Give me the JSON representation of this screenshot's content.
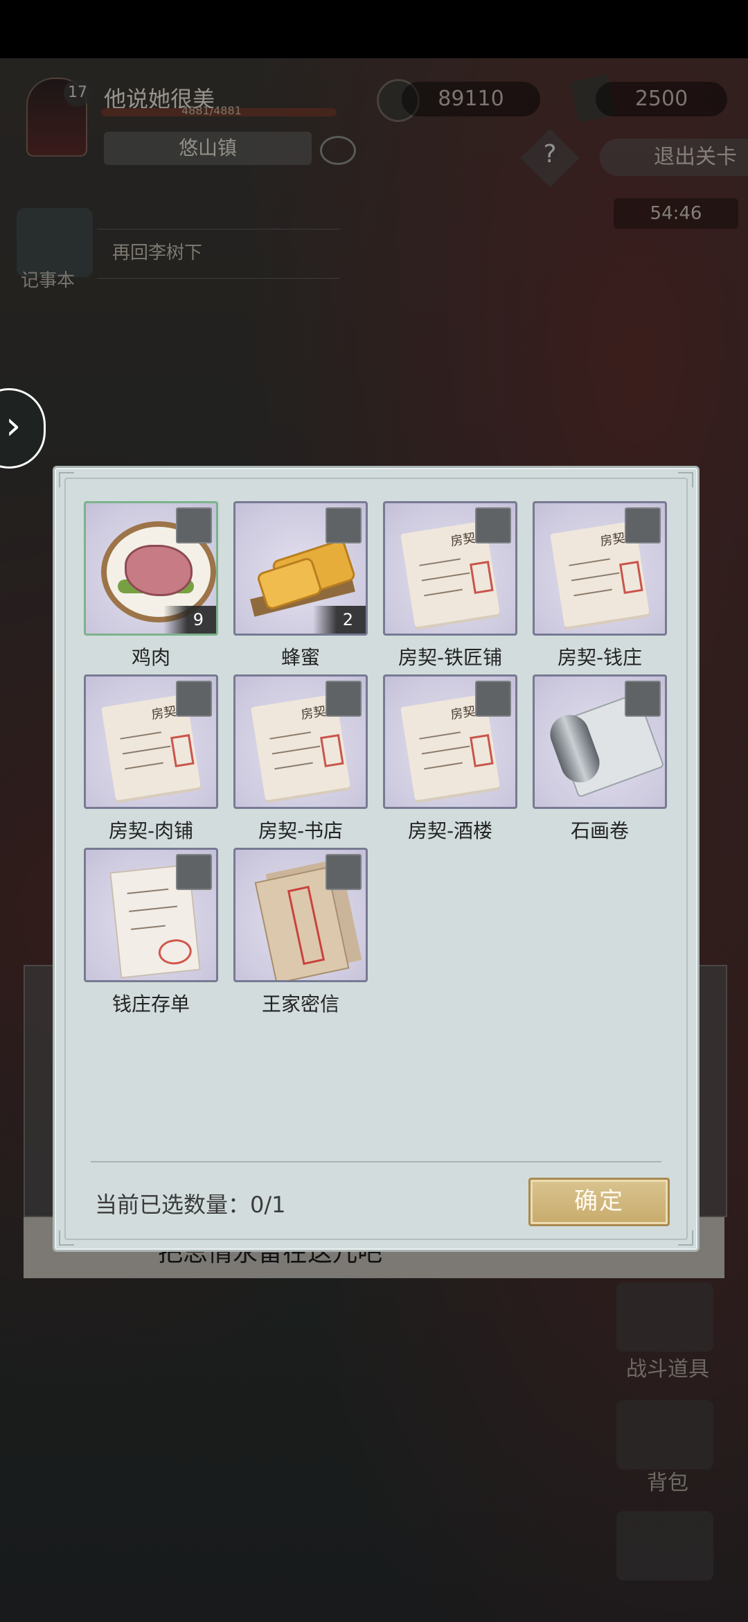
{
  "hud": {
    "level": "17",
    "player_name": "他说她很美",
    "hp_text": "4881/4881",
    "location": "悠山镇",
    "coins": "89110",
    "tickets": "2500",
    "help": "?",
    "exit_label": "退出关卡",
    "timer": "54:46",
    "journal_label": "记事本",
    "quest_text": "再回李树下"
  },
  "background": {
    "dialog_text": "把思情永留在这儿吧",
    "battle_items_label": "战斗道具",
    "bag_label": "背包"
  },
  "modal": {
    "items": [
      {
        "name": "鸡肉",
        "count": "9",
        "icon": "chicken-meat-icon",
        "selected": true
      },
      {
        "name": "蜂蜜",
        "count": "2",
        "icon": "honey-icon",
        "selected": false
      },
      {
        "name": "房契-铁匠铺",
        "count": "",
        "icon": "deed-icon",
        "selected": false
      },
      {
        "name": "房契-钱庄",
        "count": "",
        "icon": "deed-icon",
        "selected": false
      },
      {
        "name": "房契-肉铺",
        "count": "",
        "icon": "deed-icon",
        "selected": false
      },
      {
        "name": "房契-书店",
        "count": "",
        "icon": "deed-icon",
        "selected": false
      },
      {
        "name": "房契-酒楼",
        "count": "",
        "icon": "deed-icon",
        "selected": false
      },
      {
        "name": "石画卷",
        "count": "",
        "icon": "stone-scroll-icon",
        "selected": false
      },
      {
        "name": "钱庄存单",
        "count": "",
        "icon": "bank-slip-icon",
        "selected": false
      },
      {
        "name": "王家密信",
        "count": "",
        "icon": "secret-letter-icon",
        "selected": false
      }
    ],
    "deed_glyph": "房契",
    "selected_count_text": "当前已选数量：0/1",
    "confirm_label": "确定"
  },
  "colors": {
    "selected_border": "#7bb38c",
    "tile_border": "#777a92",
    "confirm_bg": "#c8ab6c"
  }
}
